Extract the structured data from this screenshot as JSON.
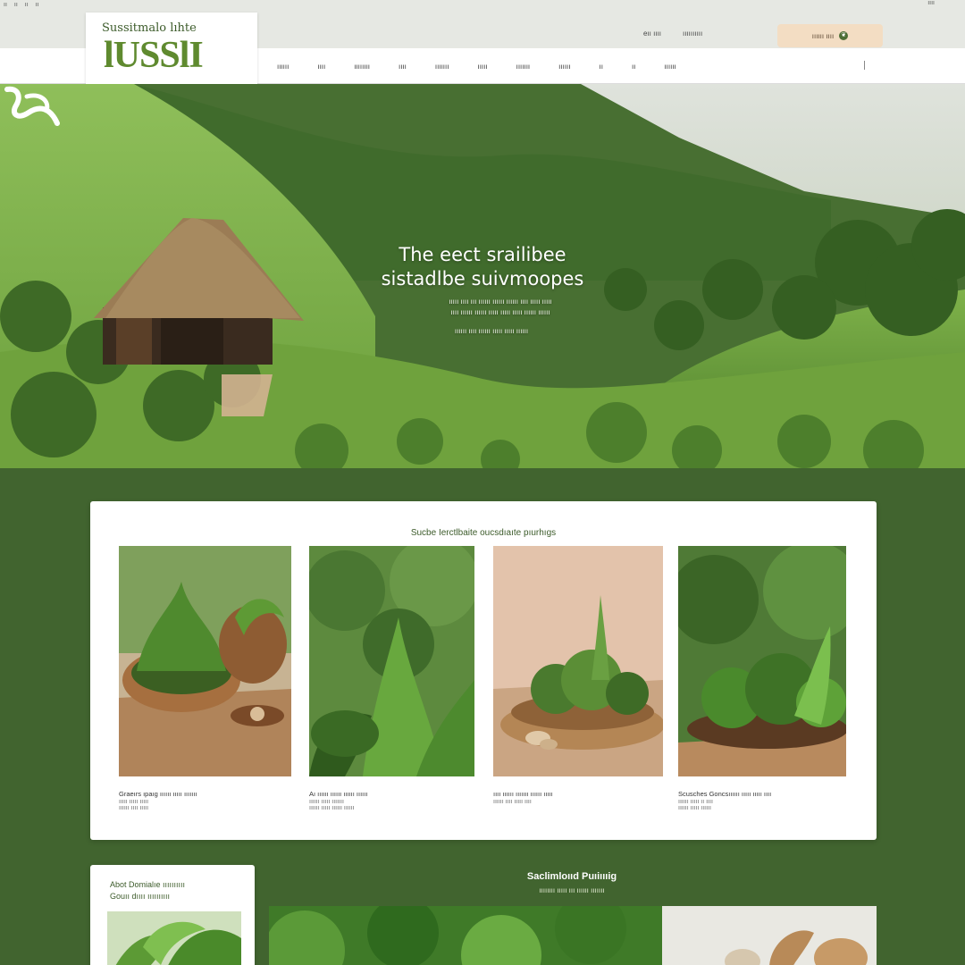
{
  "utility": {
    "links": [
      "ıı",
      "ıı",
      "ıı",
      "ıı"
    ],
    "right_text": "ıııı",
    "account": [
      "eıı ıııı",
      "ıııııııııı"
    ],
    "cta_label": "ıııııı ıııı",
    "cta_icon": "leaf-icon"
  },
  "brand": {
    "tagline": "Sussitmalo lıhte",
    "wordmark": "lUSSlI"
  },
  "nav": {
    "items": [
      "ıııııı",
      "ıııı",
      "ıııııııı",
      "ıııı",
      "ııııııı",
      "ııııı",
      "ııııııı",
      "ıııııı",
      "ıı",
      "ıı",
      "ıııııı"
    ]
  },
  "hero": {
    "title_line1": "The eect srailibee",
    "title_line2": "sistadlbe suivmoopes",
    "body_line1": "ııııı ıııı ııı ıııııı ıııııı ıııııı ıııı ııııı ııııı",
    "body_line2": "ıııı ıııııı ıııııı ııııı ııııı ııııı ıııııı ıııııı",
    "note": "ıııııı ıııı ıııııı ııııı ııııı ıııııı"
  },
  "products": {
    "section_title": "Sucbe Ierctlbaite oucsdıaıte pıurhıgs",
    "items": [
      {
        "desc": "Graeırs ıpaıg ıııııı ııııı ııııııı",
        "meta1": "ııııı ııııı ııııı",
        "meta2": "ıııııı ıııı ııııı"
      },
      {
        "desc": "Aı ıııııı ıııııı ıııııı ıııııı",
        "meta1": "ıııııı ııııı ııııııı",
        "meta2": "ıııııı ııııı ıııııı ıııııı"
      },
      {
        "desc": "ıııı ıııııı ııııııı ıııııı ııııı",
        "meta1": "",
        "meta2": "ıııııı ıııı ııııı ıııı"
      },
      {
        "desc": "Scusches Goncsıııııı ııııı ııııı ıııı",
        "meta1": "ıııııı ııııı ıı ıııı",
        "meta2": "ıııııı ııııı ıııııı"
      }
    ]
  },
  "about": {
    "title_line1": "Abot Domialıe ıııııııııı",
    "title_line2": "Gouıı dıııı ıııııııııı"
  },
  "bottom": {
    "title": "Saclimloııd Puıiıııig",
    "subtitle": "ıııııııı ııııı ııı ıııııı ııııııı"
  },
  "colors": {
    "brand_green": "#5f8a2f",
    "page_green": "#41642f",
    "cta_peach": "#f3ddc3"
  }
}
